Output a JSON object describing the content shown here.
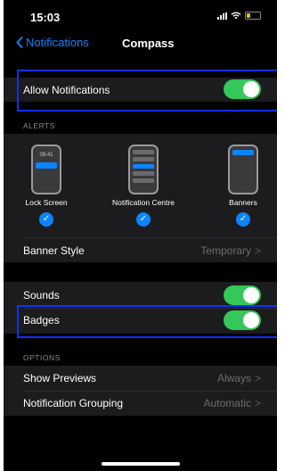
{
  "status_bar": {
    "time": "15:03"
  },
  "nav": {
    "back_label": "Notifications",
    "title": "Compass"
  },
  "allow_notifications": {
    "label": "Allow Notifications",
    "on": true
  },
  "alerts": {
    "header": "ALERTS",
    "options": [
      {
        "label": "Lock Screen",
        "time": "09:41",
        "checked": true
      },
      {
        "label": "Notification Centre",
        "checked": true
      },
      {
        "label": "Banners",
        "checked": true
      }
    ],
    "banner_style": {
      "label": "Banner Style",
      "value": "Temporary"
    }
  },
  "sounds": {
    "label": "Sounds",
    "on": true
  },
  "badges": {
    "label": "Badges",
    "on": true
  },
  "options": {
    "header": "OPTIONS",
    "show_previews": {
      "label": "Show Previews",
      "value": "Always"
    },
    "notification_grouping": {
      "label": "Notification Grouping",
      "value": "Automatic"
    }
  },
  "colors": {
    "accent": "#0a84ff",
    "toggle_on": "#34c759",
    "highlight": "#1030ff"
  },
  "icons": {
    "back": "chevron-left-icon",
    "disclosure": "chevron-right-icon",
    "check": "checkmark-icon"
  }
}
